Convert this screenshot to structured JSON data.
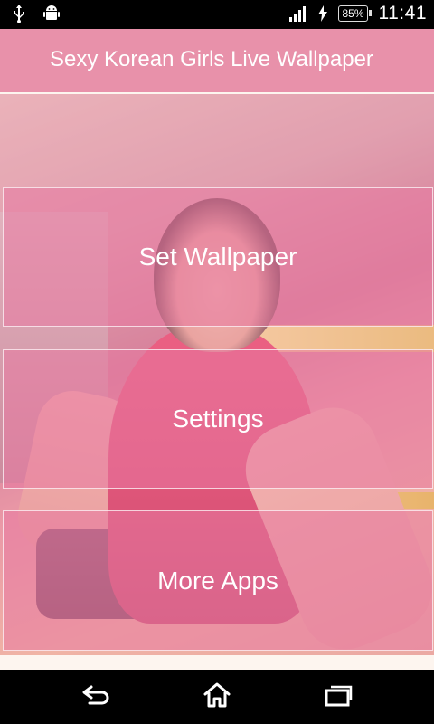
{
  "status_bar": {
    "time": "11:41",
    "battery": "85%",
    "icons": [
      "usb-icon",
      "android-debug-icon",
      "signal-icon",
      "charging-icon",
      "battery-icon"
    ]
  },
  "header": {
    "title": "Sexy Korean Girls Live Wallpaper"
  },
  "menu": {
    "buttons": [
      {
        "label": "Set Wallpaper"
      },
      {
        "label": "Settings"
      },
      {
        "label": "More Apps"
      }
    ]
  },
  "nav_bar": {
    "icons": [
      "back-icon",
      "home-icon",
      "recent-apps-icon"
    ]
  },
  "colors": {
    "header_bg": "#e891aa",
    "content_bg": "#fdf5ef",
    "button_overlay": "rgba(232,120,160,0.55)"
  }
}
